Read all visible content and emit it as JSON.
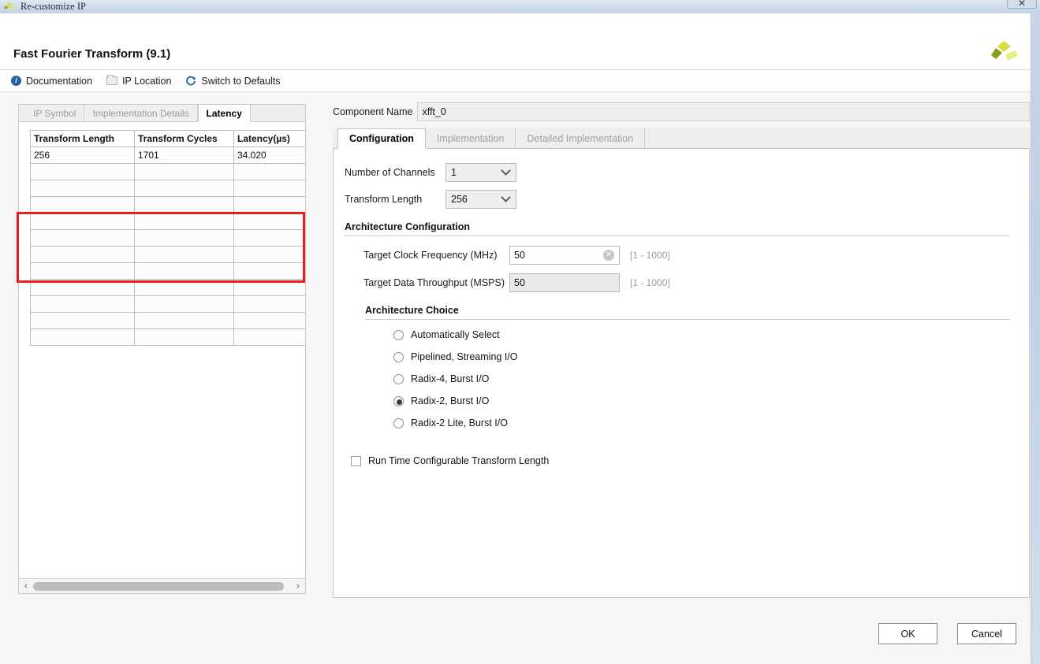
{
  "window": {
    "title": "Re-customize IP",
    "close_label": "✕"
  },
  "header": {
    "title": "Fast Fourier Transform (9.1)",
    "logo_name": "xilinx-logo"
  },
  "toolbar": {
    "items": [
      {
        "label": "Documentation",
        "icon": "info-icon"
      },
      {
        "label": "IP Location",
        "icon": "folder-icon"
      },
      {
        "label": "Switch to Defaults",
        "icon": "refresh-icon"
      }
    ]
  },
  "left_panel": {
    "tabs": [
      {
        "label": "IP Symbol",
        "active": false
      },
      {
        "label": "Implementation Details",
        "active": false
      },
      {
        "label": "Latency",
        "active": true
      }
    ],
    "table": {
      "columns": [
        "Transform Length",
        "Transform Cycles",
        "Latency(µs)"
      ],
      "rows": [
        [
          "256",
          "1701",
          "34.020"
        ]
      ],
      "empty_row_count": 11
    },
    "scrollbar": {
      "left_arrow": "‹",
      "right_arrow": "›"
    }
  },
  "right_panel": {
    "component_name_label": "Component Name",
    "component_name_value": "xfft_0",
    "tabs": [
      {
        "label": "Configuration",
        "active": true
      },
      {
        "label": "Implementation",
        "active": false
      },
      {
        "label": "Detailed Implementation",
        "active": false
      }
    ],
    "fields": {
      "num_channels_label": "Number of Channels",
      "num_channels_value": "1",
      "transform_length_label": "Transform Length",
      "transform_length_value": "256"
    },
    "architecture_configuration": {
      "title": "Architecture Configuration",
      "clock_freq_label": "Target Clock Frequency (MHz)",
      "clock_freq_value": "50",
      "clock_freq_hint": "[1 - 1000]",
      "throughput_label": "Target Data Throughput (MSPS)",
      "throughput_value": "50",
      "throughput_hint": "[1 - 1000]"
    },
    "architecture_choice": {
      "title": "Architecture Choice",
      "options": [
        {
          "label": "Automatically Select",
          "selected": false
        },
        {
          "label": "Pipelined, Streaming I/O",
          "selected": false
        },
        {
          "label": "Radix-4, Burst I/O",
          "selected": false
        },
        {
          "label": "Radix-2, Burst I/O",
          "selected": true
        },
        {
          "label": "Radix-2 Lite, Burst I/O",
          "selected": false
        }
      ]
    },
    "runtime_checkbox": {
      "label": "Run Time Configurable Transform Length",
      "checked": false
    }
  },
  "footer": {
    "ok_label": "OK",
    "cancel_label": "Cancel"
  },
  "colors": {
    "annotation": "#ee1b1b",
    "accent_blue": "#2b5fa8",
    "logo_green": "#c8d632",
    "logo_olive": "#9aa320"
  }
}
